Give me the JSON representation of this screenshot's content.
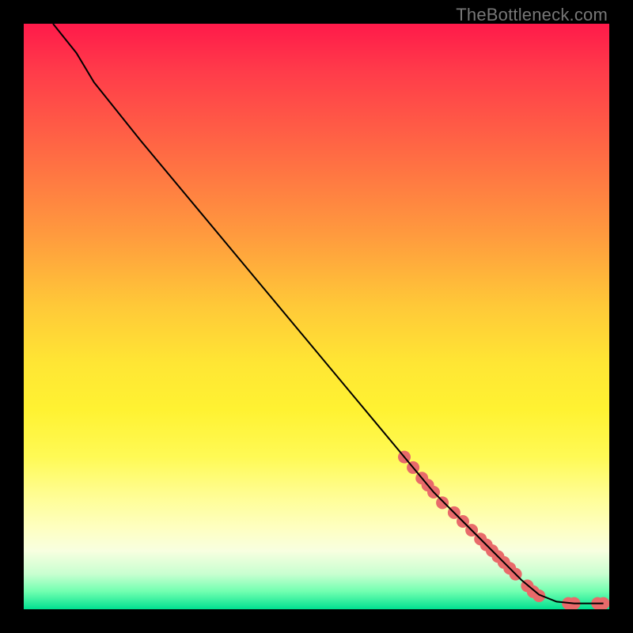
{
  "attribution": "TheBottleneck.com",
  "chart_data": {
    "type": "line",
    "title": "",
    "xlabel": "",
    "ylabel": "",
    "xlim": [
      0,
      100
    ],
    "ylim": [
      0,
      100
    ],
    "curve": [
      {
        "x": 5,
        "y": 100
      },
      {
        "x": 9,
        "y": 95
      },
      {
        "x": 12,
        "y": 90
      },
      {
        "x": 20,
        "y": 80
      },
      {
        "x": 30,
        "y": 68
      },
      {
        "x": 40,
        "y": 56
      },
      {
        "x": 50,
        "y": 44
      },
      {
        "x": 60,
        "y": 32
      },
      {
        "x": 65,
        "y": 26
      },
      {
        "x": 70,
        "y": 20
      },
      {
        "x": 75,
        "y": 15
      },
      {
        "x": 80,
        "y": 10
      },
      {
        "x": 85,
        "y": 5
      },
      {
        "x": 88,
        "y": 2.5
      },
      {
        "x": 91,
        "y": 1.3
      },
      {
        "x": 94,
        "y": 1.0
      },
      {
        "x": 97,
        "y": 1.0
      },
      {
        "x": 99,
        "y": 1.0
      }
    ],
    "marker_clusters": [
      {
        "x": 65,
        "y": 26
      },
      {
        "x": 66.5,
        "y": 24.2
      },
      {
        "x": 68,
        "y": 22.4
      },
      {
        "x": 69,
        "y": 21.2
      },
      {
        "x": 70,
        "y": 20
      },
      {
        "x": 71.5,
        "y": 18.2
      },
      {
        "x": 73.5,
        "y": 16.5
      },
      {
        "x": 75,
        "y": 15
      },
      {
        "x": 76.5,
        "y": 13.5
      },
      {
        "x": 78,
        "y": 12
      },
      {
        "x": 79,
        "y": 11
      },
      {
        "x": 80,
        "y": 10
      },
      {
        "x": 81,
        "y": 9
      },
      {
        "x": 82,
        "y": 8
      },
      {
        "x": 83,
        "y": 7
      },
      {
        "x": 84,
        "y": 6
      },
      {
        "x": 86,
        "y": 4
      },
      {
        "x": 87,
        "y": 3
      },
      {
        "x": 88,
        "y": 2.3
      },
      {
        "x": 93,
        "y": 1.0
      },
      {
        "x": 94,
        "y": 1.0
      },
      {
        "x": 98,
        "y": 1.0
      },
      {
        "x": 99,
        "y": 1.0
      }
    ],
    "marker_radius": 8,
    "marker_color": "#e86a6a",
    "line_color": "#000000"
  }
}
